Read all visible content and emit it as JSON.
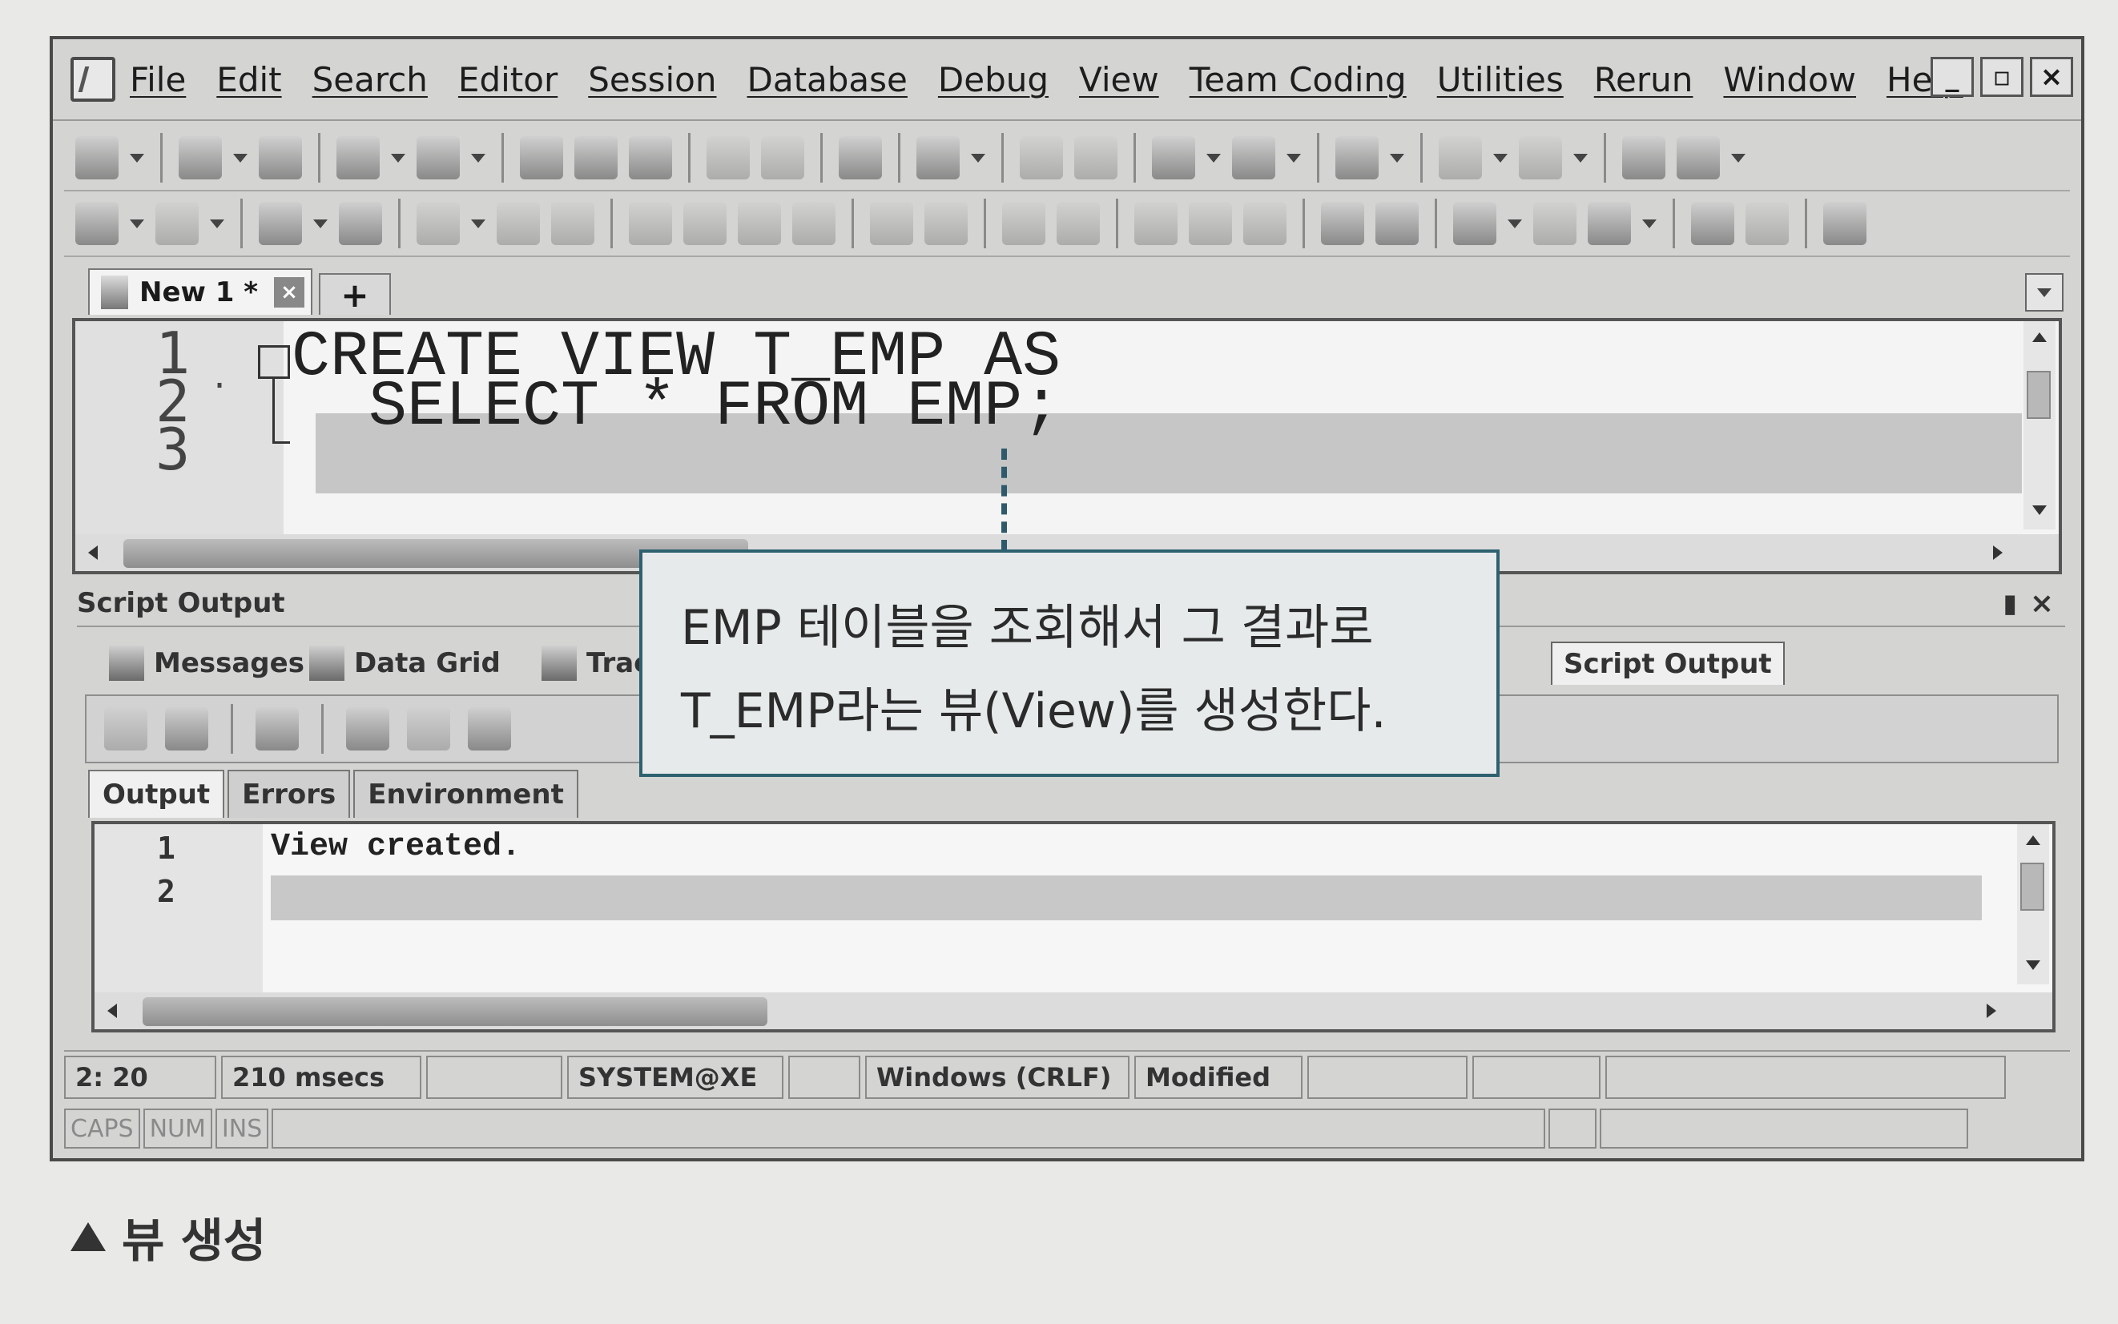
{
  "menu": [
    "File",
    "Edit",
    "Search",
    "Editor",
    "Session",
    "Database",
    "Debug",
    "View",
    "Team Coding",
    "Utilities",
    "Rerun",
    "Window",
    "Help"
  ],
  "doc_tab": {
    "label": "New 1 *",
    "add": "+"
  },
  "editor": {
    "lines": [
      {
        "num": "1",
        "code": "CREATE VIEW T_EMP AS"
      },
      {
        "num": "2",
        "code": "  SELECT * FROM EMP;"
      },
      {
        "num": "3",
        "code": ""
      }
    ]
  },
  "output_panel": {
    "title": "Script Output",
    "tabs": [
      "Messages",
      "Data Grid",
      "Trace",
      "Script Output"
    ],
    "sub_tabs": [
      "Output",
      "Errors",
      "Environment"
    ],
    "lines": [
      {
        "num": "1",
        "text": "View created."
      },
      {
        "num": "2",
        "text": ""
      }
    ]
  },
  "status": {
    "position": "2: 20",
    "time": "210 msecs",
    "connection": "SYSTEM@XE",
    "line_ending": "Windows (CRLF)",
    "state": "Modified",
    "caps": "CAPS",
    "num": "NUM",
    "ins": "INS"
  },
  "callout": {
    "line1": "EMP 테이블을 조회해서 그 결과로",
    "line2": "T_EMP라는 뷰(View)를 생성한다."
  },
  "caption": "뷰 생성",
  "colors": {
    "callout_border": "#2e6170",
    "callout_bg": "#e6eaea",
    "line_highlight": "#c6c6c6"
  }
}
